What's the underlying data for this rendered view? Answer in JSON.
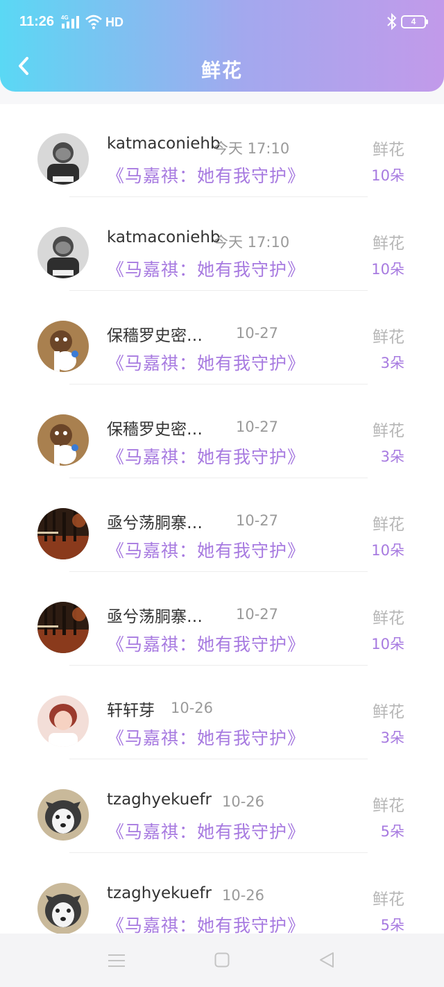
{
  "status_bar": {
    "time": "11:26",
    "network": "4G",
    "hd": "HD",
    "battery": "4"
  },
  "header": {
    "title": "鲜花",
    "back_icon": "chevron-left-icon"
  },
  "colors": {
    "header_gradient_start": "#5ad8f4",
    "header_gradient_end": "#c29aea",
    "accent_purple": "#a77ae0",
    "muted_gray": "#9a9a9a"
  },
  "entries": [
    {
      "name": "katmaconiehb",
      "time": "今天 17:10",
      "book": "《马嘉祺：她有我守护》",
      "gift": "鲜花",
      "count": "10朵",
      "avatar": "grayscale-person"
    },
    {
      "name": "katmaconiehb",
      "time": "今天 17:10",
      "book": "《马嘉祺：她有我守护》",
      "gift": "鲜花",
      "count": "10朵",
      "avatar": "grayscale-person"
    },
    {
      "name": "保穡罗史密…",
      "time": "10-27",
      "book": "《马嘉祺：她有我守护》",
      "gift": "鲜花",
      "count": "3朵",
      "avatar": "cartoon-bear"
    },
    {
      "name": "保穡罗史密…",
      "time": "10-27",
      "book": "《马嘉祺：她有我守护》",
      "gift": "鲜花",
      "count": "3朵",
      "avatar": "cartoon-bear"
    },
    {
      "name": "亟兮荡胴寨…",
      "time": "10-27",
      "book": "《马嘉祺：她有我守护》",
      "gift": "鲜花",
      "count": "10朵",
      "avatar": "autumn-trees"
    },
    {
      "name": "亟兮荡胴寨…",
      "time": "10-27",
      "book": "《马嘉祺：她有我守护》",
      "gift": "鲜花",
      "count": "10朵",
      "avatar": "autumn-trees"
    },
    {
      "name": "轩轩芽",
      "time": "10-26",
      "book": "《马嘉祺：她有我守护》",
      "gift": "鲜花",
      "count": "3朵",
      "avatar": "portrait-girl"
    },
    {
      "name": "tzaghyekuefr",
      "time": "10-26",
      "book": "《马嘉祺：她有我守护》",
      "gift": "鲜花",
      "count": "5朵",
      "avatar": "husky-puppy"
    },
    {
      "name": "tzaghyekuefr",
      "time": "10-26",
      "book": "《马嘉祺：她有我守护》",
      "gift": "鲜花",
      "count": "5朵",
      "avatar": "husky-puppy"
    }
  ],
  "nav": {
    "menu_icon": "menu-icon",
    "home_icon": "home-square-icon",
    "back_icon": "back-triangle-icon"
  }
}
